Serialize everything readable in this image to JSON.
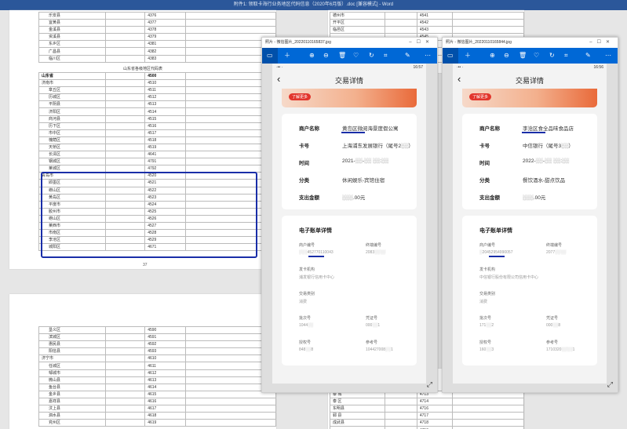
{
  "word": {
    "title": "附件1: 领取卡海行业务地区代码信息（2020年6月版）.doc [兼容模式] - Word",
    "page_number": "37",
    "top_rows": [
      [
        "乐安县",
        "",
        "4376",
        ""
      ],
      [
        "宜黄县",
        "",
        "4377",
        ""
      ],
      [
        "金溪县",
        "",
        "4378",
        ""
      ],
      [
        "资溪县",
        "",
        "4379",
        ""
      ],
      [
        "东乡区",
        "",
        "4381",
        ""
      ],
      [
        "广昌县",
        "",
        "4382",
        ""
      ],
      [
        "临川区",
        "",
        "4383",
        ""
      ]
    ],
    "section_title": "山东省各级地区代码表",
    "province_row": [
      "山东省",
      "",
      "4500",
      ""
    ],
    "jinan_rows": [
      [
        "济南市",
        "",
        "4510",
        ""
      ],
      [
        "章丘区",
        "",
        "4511",
        ""
      ],
      [
        "历城区",
        "",
        "4512",
        ""
      ],
      [
        "平阴县",
        "",
        "4513",
        ""
      ],
      [
        "济阳区",
        "",
        "4514",
        ""
      ],
      [
        "商河县",
        "",
        "4515",
        ""
      ],
      [
        "历下区",
        "",
        "4516",
        ""
      ],
      [
        "市中区",
        "",
        "4517",
        ""
      ],
      [
        "槐荫区",
        "",
        "4518",
        ""
      ],
      [
        "天桥区",
        "",
        "4519",
        ""
      ],
      [
        "长清区",
        "",
        "4641",
        ""
      ],
      [
        "钢城区",
        "",
        "4791",
        ""
      ],
      [
        "莱城区",
        "",
        "4792",
        ""
      ]
    ],
    "qingdao_rows": [
      [
        "青岛市",
        "",
        "4520",
        ""
      ],
      [
        "即墨区",
        "",
        "4521",
        ""
      ],
      [
        "崂山区",
        "",
        "4522",
        ""
      ],
      [
        "黄岛区",
        "",
        "4523",
        ""
      ],
      [
        "平度市",
        "",
        "4524",
        ""
      ],
      [
        "胶州市",
        "",
        "4525",
        ""
      ],
      [
        "崂山区",
        "",
        "4526",
        ""
      ],
      [
        "莱西市",
        "",
        "4527",
        ""
      ],
      [
        "市南区",
        "",
        "4528",
        ""
      ],
      [
        "李沧区",
        "",
        "4529",
        ""
      ],
      [
        "城阳区",
        "",
        "4671",
        ""
      ]
    ],
    "page2_rows": [
      [
        "垦义区",
        "",
        "4590",
        ""
      ],
      [
        "滨城区",
        "",
        "4591",
        ""
      ],
      [
        "惠民县",
        "",
        "4592",
        ""
      ],
      [
        "阳信县",
        "",
        "4593",
        ""
      ],
      [
        "济宁市",
        "",
        "4610",
        ""
      ],
      [
        "任城区",
        "",
        "4611",
        ""
      ],
      [
        "邹城市",
        "",
        "4612",
        ""
      ],
      [
        "微山县",
        "",
        "4613",
        ""
      ],
      [
        "鱼台县",
        "",
        "4614",
        ""
      ],
      [
        "金乡县",
        "",
        "4615",
        ""
      ],
      [
        "嘉祥县",
        "",
        "4616",
        ""
      ],
      [
        "汶上县",
        "",
        "4617",
        ""
      ],
      [
        "泗水县",
        "",
        "4618",
        ""
      ],
      [
        "兖州区",
        "",
        "4619",
        ""
      ]
    ],
    "right_rows_top": [
      [
        "德州市",
        "",
        "4541",
        ""
      ],
      [
        "开平区",
        "",
        "4542",
        ""
      ],
      [
        "临邑区",
        "",
        "4543",
        ""
      ],
      [
        "",
        "",
        "4545",
        ""
      ],
      [
        "",
        "",
        "4546",
        ""
      ],
      [
        "",
        "",
        "4547",
        ""
      ],
      [
        "",
        "",
        "4548",
        ""
      ]
    ],
    "right_rows_bottom": [
      [
        "",
        "",
        "4713",
        ""
      ],
      [
        "",
        "",
        "4714",
        ""
      ],
      [
        "",
        "",
        "4716",
        ""
      ],
      [
        "",
        "",
        "4717",
        ""
      ],
      [
        "",
        "",
        "4718",
        ""
      ],
      [
        "",
        "",
        "4719",
        ""
      ]
    ],
    "right_labels_bottom": [
      "泰 城",
      "泰 区",
      "东明县",
      "郓 县",
      "成武县"
    ]
  },
  "viewer1": {
    "title": "照片 - 微信图片_20220110165837.jpg",
    "status_time": "16:57",
    "status_left": "·•• ·",
    "nav_title": "交易详情",
    "banner_btn": "了解更多",
    "rows": [
      {
        "k": "商户名称",
        "v": "黄岛区微阅海景度假公寓"
      },
      {
        "k": "卡号",
        "v": "上海浦东发展银行（尾号2░░）"
      },
      {
        "k": "时间",
        "v": "2021-░░-░░ ░░:░░"
      },
      {
        "k": "分类",
        "v": "休闲娱乐-宾馆住宿"
      },
      {
        "k": "支出金额",
        "v": "░░░.00元"
      }
    ],
    "section": "电子账单详情",
    "grid": [
      {
        "k1": "商户编号",
        "v1": "░░░452770110043",
        "k2": "终端编号",
        "v2": "2083░░░░"
      },
      {
        "k1": "发卡机构",
        "v1": "浦发银行信用卡中心",
        "k2": "",
        "v2": ""
      },
      {
        "k1": "交易类别",
        "v1": "消费",
        "k2": "",
        "v2": ""
      },
      {
        "k1": "批次号",
        "v1": "1044░░",
        "k2": "凭证号",
        "v2": "000░░1"
      },
      {
        "k1": "授权号",
        "v1": "848░░8",
        "k2": "参考号",
        "v2": "104427008░░1"
      }
    ]
  },
  "viewer2": {
    "title": "照片 - 微信图片_20220110165844.jpg",
    "status_time": "16:56",
    "status_left": "·•• ·",
    "nav_title": "交易详情",
    "banner_btn": "了解更多",
    "rows": [
      {
        "k": "商户名称",
        "v": "李沧区食全品味食品店"
      },
      {
        "k": "卡号",
        "v": "中信银行（尾号3░░）"
      },
      {
        "k": "时间",
        "v": "2022-░░-░░ ░░:░░"
      },
      {
        "k": "分类",
        "v": "餐饮酒水-甜点饮品"
      },
      {
        "k": "支出金额",
        "v": "░░░.00元"
      }
    ],
    "section": "电子账单详情",
    "grid": [
      {
        "k1": "商户编号",
        "v1": "░20452954990057",
        "k2": "终端编号",
        "v2": "2077░░░░"
      },
      {
        "k1": "发卡机构",
        "v1": "中信银行股份有限公司信用卡中心",
        "k2": "",
        "v2": ""
      },
      {
        "k1": "交易类别",
        "v1": "消费",
        "k2": "",
        "v2": ""
      },
      {
        "k1": "批次号",
        "v1": "171░░2",
        "k2": "凭证号",
        "v2": "000░░8"
      },
      {
        "k1": "授权号",
        "v1": "160░░3",
        "k2": "参考号",
        "v2": "1710320░░░░1"
      }
    ]
  },
  "colors": {
    "highlight": "#1a2ea8",
    "toolbar": "#0068d6",
    "word_bar": "#2b579a"
  }
}
